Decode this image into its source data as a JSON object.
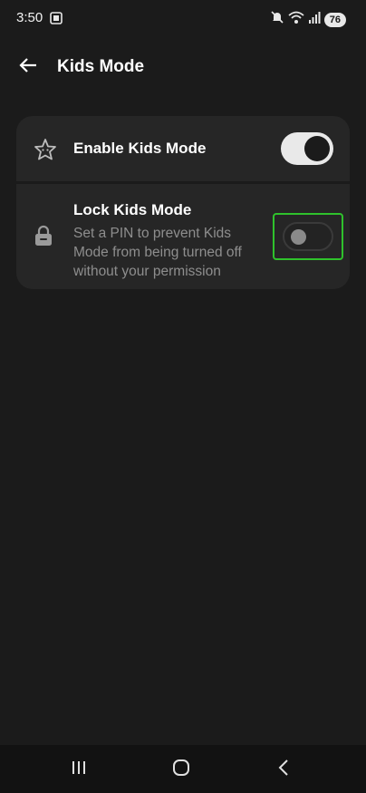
{
  "status_bar": {
    "time": "3:50",
    "left_icon": "screen-capture-icon",
    "icons": [
      "mute-icon",
      "wifi-icon",
      "signal-icon"
    ],
    "battery": "76"
  },
  "app_bar": {
    "back_icon": "arrow-back-icon",
    "title": "Kids Mode"
  },
  "settings": {
    "enable": {
      "icon": "star-face-icon",
      "label": "Enable Kids Mode",
      "toggle_on": true
    },
    "lock": {
      "icon": "lock-icon",
      "title": "Lock Kids Mode",
      "description": "Set a PIN to prevent Kids Mode from being turned off without your permission",
      "toggle_on": false
    }
  },
  "highlight_color": "#2fc22c",
  "nav_bar": {
    "recents_icon": "recents-icon",
    "home_icon": "home-icon",
    "back_icon": "back-chevron-icon"
  }
}
